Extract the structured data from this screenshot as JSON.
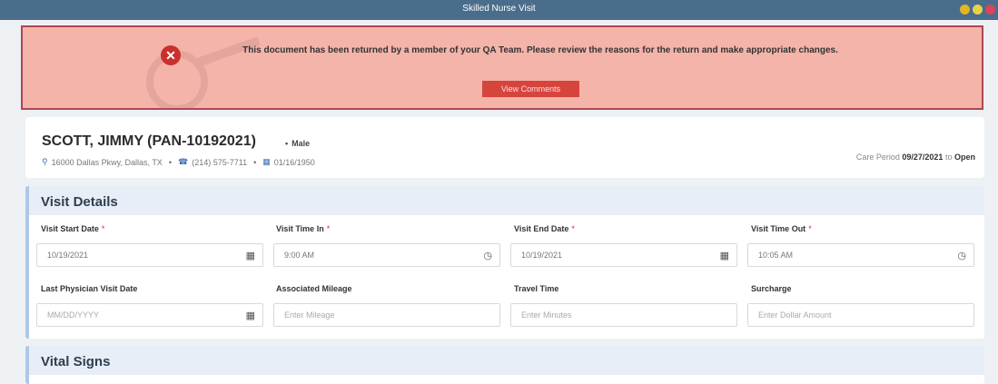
{
  "window": {
    "title": "Skilled Nurse Visit",
    "buttons": [
      "#e6b422",
      "#e6d24b",
      "#d9455a"
    ]
  },
  "alert": {
    "message": "This document has been returned by a member of your QA Team. Please review the reasons for the return and make appropriate changes.",
    "button_label": "View Comments"
  },
  "patient": {
    "name": "SCOTT, JIMMY (PAN-10192021)",
    "separator": "•",
    "sex": "Male",
    "address": "16000 Dallas Pkwy, Dallas, TX",
    "phone": "(214) 575-7711",
    "dob": "01/16/1950",
    "care_period_label": "Care Period",
    "care_period_start": "09/27/2021",
    "care_period_to": "to",
    "care_period_end": "Open"
  },
  "visit_details": {
    "title": "Visit Details",
    "required_marker": "*",
    "fields": [
      {
        "label": "Visit Start Date",
        "value": "10/19/2021",
        "required": true,
        "icon": "calendar-icon"
      },
      {
        "label": "Visit Time In",
        "value": "9:00 AM",
        "required": true,
        "icon": "clock-icon"
      },
      {
        "label": "Visit End Date",
        "value": "10/19/2021",
        "required": true,
        "icon": "calendar-icon"
      },
      {
        "label": "Visit Time Out",
        "value": "10:05 AM",
        "required": true,
        "icon": "clock-icon"
      },
      {
        "label": "Last Physician Visit Date",
        "placeholder": "MM/DD/YYYY",
        "icon": "calendar-icon"
      },
      {
        "label": "Associated Mileage",
        "placeholder": "Enter Mileage"
      },
      {
        "label": "Travel Time",
        "placeholder": "Enter Minutes"
      },
      {
        "label": "Surcharge",
        "placeholder": "Enter Dollar Amount"
      }
    ]
  },
  "vital_signs": {
    "title": "Vital Signs"
  }
}
